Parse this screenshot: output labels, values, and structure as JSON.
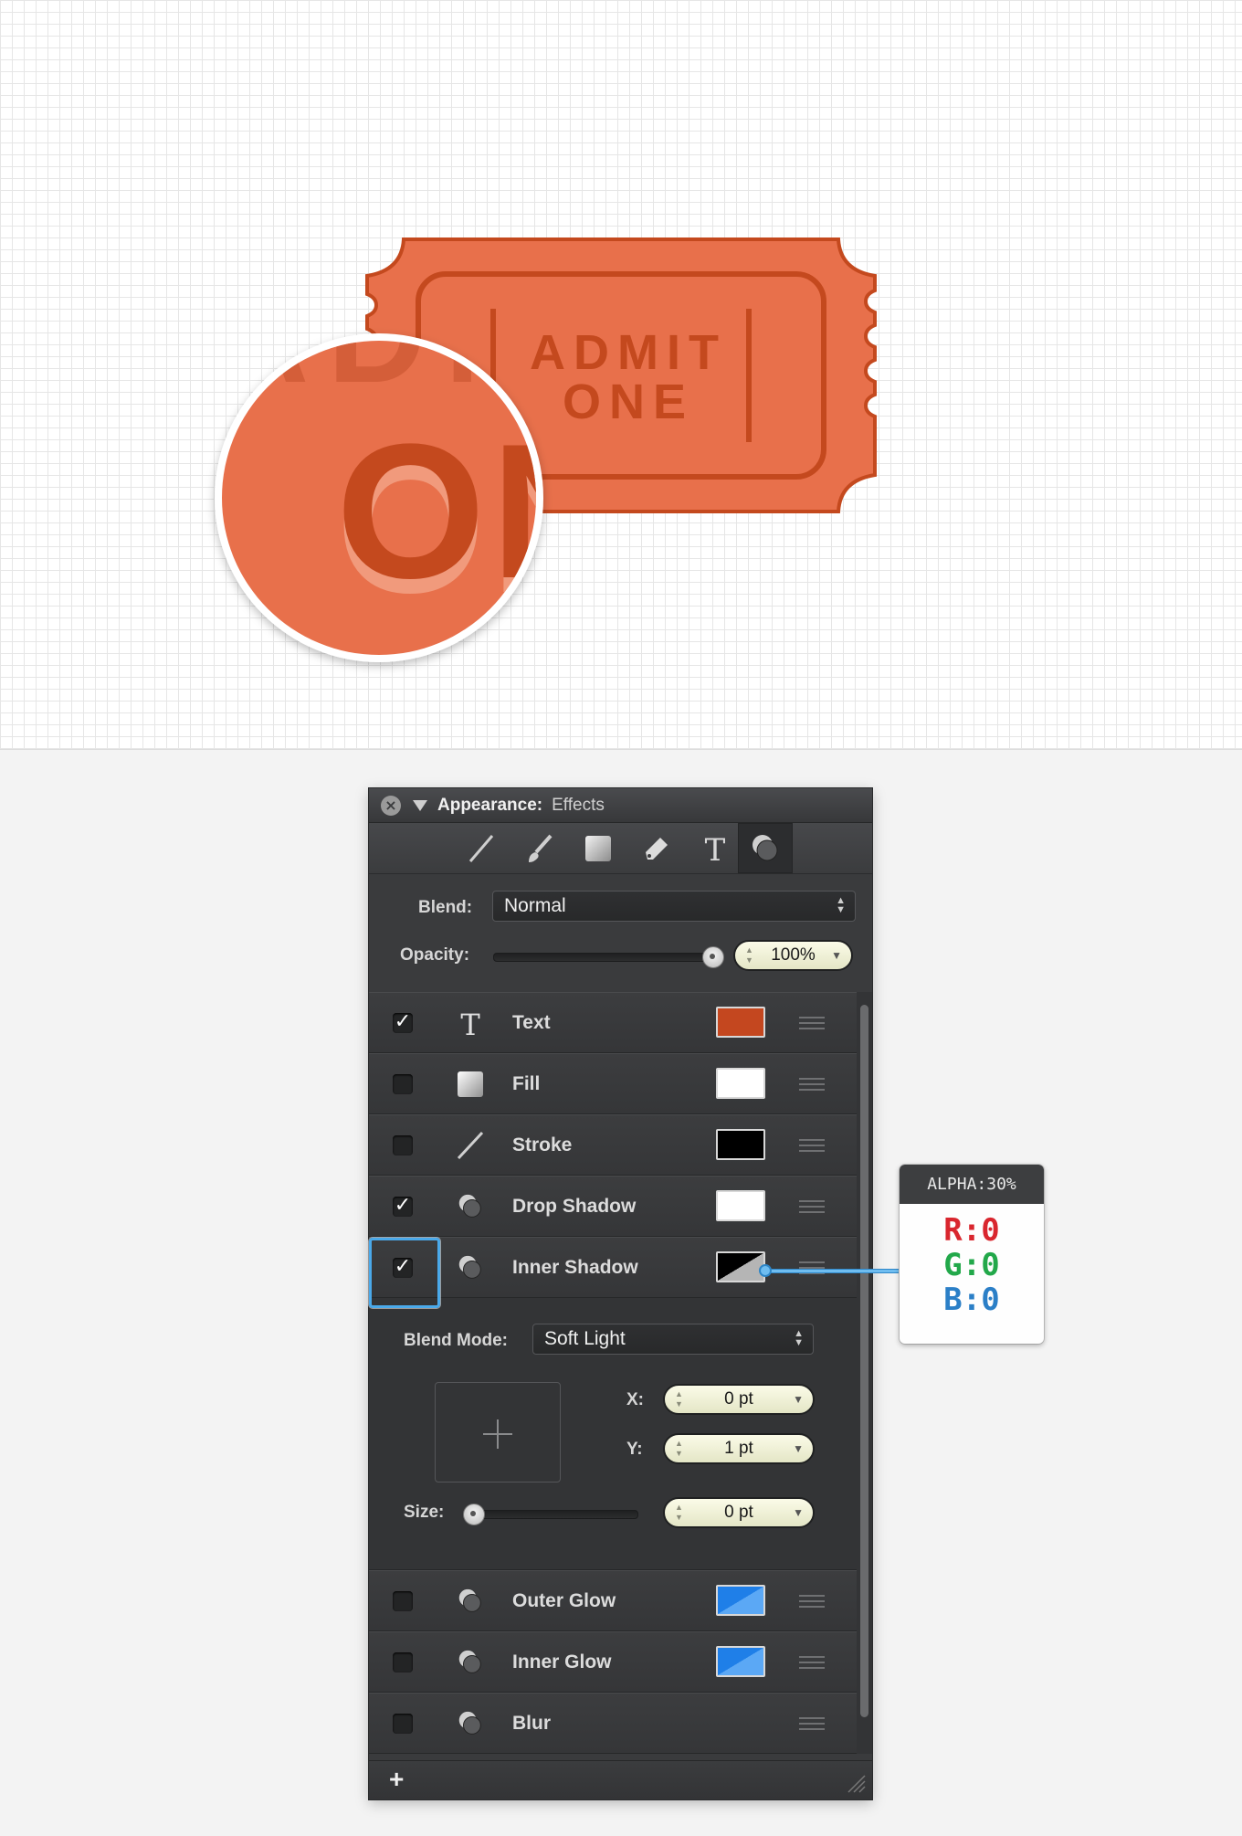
{
  "canvas": {
    "ticket": {
      "line1": "ADMIT",
      "line2": "ONE",
      "zoom_text": "ON",
      "fill_color": "#e8704b",
      "dark_color": "#c4491e"
    }
  },
  "panel": {
    "title_main": "Appearance:",
    "title_sub": "Effects",
    "toolbar_icons": [
      "stroke-tool-icon",
      "brush-tool-icon",
      "fill-tool-icon",
      "pen-tool-icon",
      "text-tool-icon",
      "effects-tool-icon"
    ],
    "blend": {
      "label": "Blend:",
      "value": "Normal"
    },
    "opacity": {
      "label": "Opacity:",
      "value": "100%",
      "level": 1.0
    },
    "effects": [
      {
        "label": "Text",
        "checked": true,
        "check_glyph": "✓",
        "icon": "text-icon",
        "swatch_color": "#c4471f"
      },
      {
        "label": "Fill",
        "checked": false,
        "icon": "fill-icon",
        "swatch_color": "#ffffff"
      },
      {
        "label": "Stroke",
        "checked": false,
        "icon": "stroke-icon",
        "swatch_color": "#000000"
      },
      {
        "label": "Drop Shadow",
        "checked": true,
        "check_glyph": "✓",
        "icon": "shadow-icon",
        "swatch_color": "#ffffff"
      },
      {
        "label": "Inner Shadow",
        "checked": true,
        "check_glyph": "✓",
        "icon": "shadow-icon",
        "swatch_color": "#000000"
      },
      {
        "label": "Outer Glow",
        "checked": false,
        "icon": "shadow-icon",
        "swatch_color": "#2b8bf0"
      },
      {
        "label": "Inner Glow",
        "checked": false,
        "icon": "shadow-icon",
        "swatch_color": "#2b8bf0"
      },
      {
        "label": "Blur",
        "checked": false,
        "icon": "shadow-icon"
      }
    ],
    "inner_shadow": {
      "blend_mode_label": "Blend Mode:",
      "blend_mode_value": "Soft Light",
      "x_label": "X:",
      "x_value": "0 pt",
      "y_label": "Y:",
      "y_value": "1 pt",
      "size_label": "Size:",
      "size_value": "0 pt",
      "size_level": 0.0
    },
    "add_label": "+"
  },
  "callout": {
    "header": "ALPHA:30%",
    "r": "R:0",
    "g": "G:0",
    "b": "B:0",
    "r_color": "#d9262e",
    "g_color": "#22a84a",
    "b_color": "#2b7fc7"
  }
}
